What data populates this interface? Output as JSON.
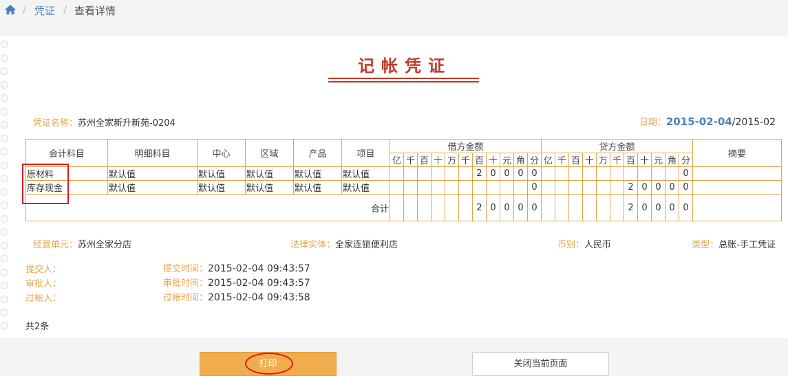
{
  "breadcrumb": {
    "item1": "凭证",
    "item2": "查看详情"
  },
  "voucher": {
    "title": "记帐凭证",
    "name_label": "凭证名称：",
    "name_value": "苏州全家新升新苑-0204",
    "date_label": "日期：",
    "date_main": "2015-02-04",
    "date_suffix": "/2015-02"
  },
  "table": {
    "headers": {
      "subject": "会计科目",
      "detail": "明细科目",
      "center": "中心",
      "region": "区域",
      "product": "产品",
      "project": "项目",
      "debit": "借方金额",
      "credit": "贷方金额",
      "summary": "摘要"
    },
    "digits": [
      "亿",
      "千",
      "百",
      "十",
      "万",
      "千",
      "百",
      "十",
      "元",
      "角",
      "分"
    ],
    "rows": [
      {
        "subject": "原材料",
        "detail": "默认值",
        "center": "默认值",
        "region": "默认值",
        "product": "默认值",
        "project": "默认值",
        "debit": [
          "",
          "",
          "",
          "",
          "",
          "",
          "2",
          "0",
          "0",
          "0",
          "0"
        ],
        "credit": [
          "",
          "",
          "",
          "",
          "",
          "",
          "",
          "",
          "",
          "",
          "0"
        ],
        "summary": ""
      },
      {
        "subject": "库存现金",
        "detail": "默认值",
        "center": "默认值",
        "region": "默认值",
        "product": "默认值",
        "project": "默认值",
        "debit": [
          "",
          "",
          "",
          "",
          "",
          "",
          "",
          "",
          "",
          "",
          "0"
        ],
        "credit": [
          "",
          "",
          "",
          "",
          "",
          "",
          "2",
          "0",
          "0",
          "0",
          "0"
        ],
        "summary": ""
      }
    ],
    "total_label": "合计",
    "total_debit": [
      "",
      "",
      "",
      "",
      "",
      "",
      "2",
      "0",
      "0",
      "0",
      "0"
    ],
    "total_credit": [
      "",
      "",
      "",
      "",
      "",
      "",
      "2",
      "0",
      "0",
      "0",
      "0"
    ]
  },
  "info": {
    "unit_label": "经营单元：",
    "unit_value": "苏州全家分店",
    "entity_label": "法律实体：",
    "entity_value": "全家连锁便利店",
    "currency_label": "币别：",
    "currency_value": "人民币",
    "type_label": "类型：",
    "type_value": "总账-手工凭证"
  },
  "people": {
    "submitter_label": "提交人：",
    "submit_time_label": "提交时间：",
    "submit_time": "2015-02-04 09:43:57",
    "approver_label": "审批人：",
    "approve_time_label": "审批时间：",
    "approve_time": "2015-02-04 09:43:57",
    "poster_label": "过帐人：",
    "post_time_label": "过帐时间：",
    "post_time": "2015-02-04 09:43:58"
  },
  "count_text": "共2条",
  "buttons": {
    "print": "打印",
    "close": "关闭当前页面"
  }
}
